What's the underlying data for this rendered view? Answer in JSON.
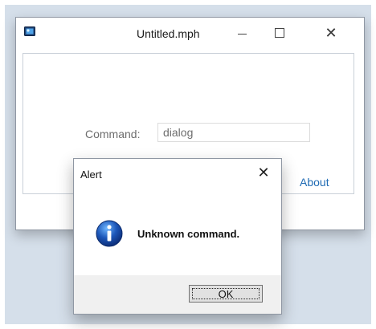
{
  "window": {
    "title": "Untitled.mph",
    "icons": {
      "app": "app-icon",
      "minimize": "minimize-icon",
      "maximize": "maximize-icon",
      "close": "close-icon"
    },
    "close_glyph": "✕"
  },
  "form": {
    "command_label": "Command:",
    "command_value": "dialog",
    "about_label": "About"
  },
  "alert": {
    "title": "Alert",
    "close_glyph": "✕",
    "icon": "info-icon",
    "message": "Unknown command.",
    "ok_label": "OK"
  },
  "colors": {
    "background": "#d5dfea",
    "link": "#1f6bb4",
    "info_blue": "#1c56b8"
  }
}
